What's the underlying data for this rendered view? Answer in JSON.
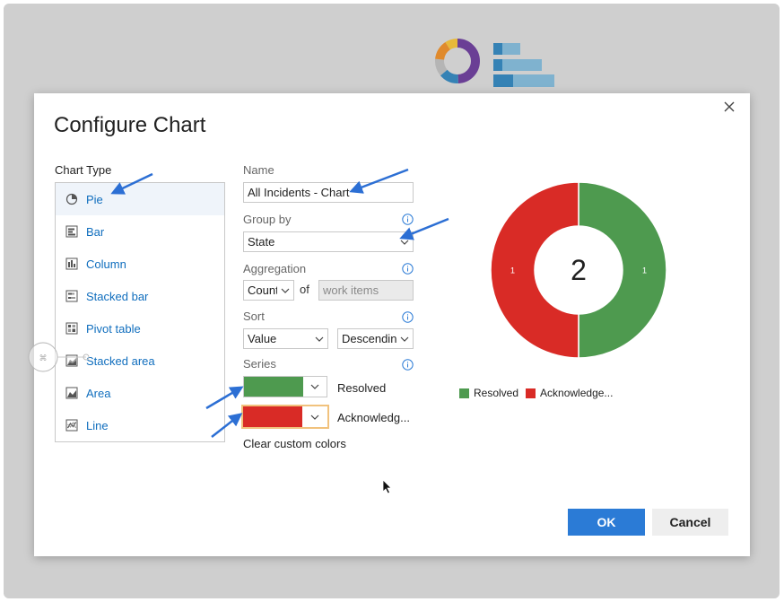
{
  "dialog": {
    "title": "Configure Chart"
  },
  "chart_type": {
    "label": "Chart Type",
    "selected": "Pie",
    "items": [
      {
        "label": "Pie",
        "icon": "pie-icon"
      },
      {
        "label": "Bar",
        "icon": "bar-icon"
      },
      {
        "label": "Column",
        "icon": "column-icon"
      },
      {
        "label": "Stacked bar",
        "icon": "stacked-bar-icon"
      },
      {
        "label": "Pivot table",
        "icon": "pivot-table-icon"
      },
      {
        "label": "Stacked area",
        "icon": "stacked-area-icon"
      },
      {
        "label": "Area",
        "icon": "area-icon"
      },
      {
        "label": "Line",
        "icon": "line-icon"
      }
    ]
  },
  "form": {
    "name_label": "Name",
    "name_value": "All Incidents - Chart",
    "group_by_label": "Group by",
    "group_by_value": "State",
    "aggregation_label": "Aggregation",
    "aggregation_value": "Count",
    "of_label": "of",
    "aggregation_field": "work items",
    "sort_label": "Sort",
    "sort_value": "Value",
    "sort_direction": "Descending",
    "series_label": "Series",
    "series": [
      {
        "name": "Resolved",
        "color": "#4e9a4f"
      },
      {
        "name": "Acknowledg...",
        "color": "#d92b26"
      }
    ],
    "clear_colors_label": "Clear custom colors"
  },
  "chart_data": {
    "type": "pie",
    "donut": true,
    "center_label": "2",
    "series": [
      {
        "name": "Resolved",
        "value": 1,
        "label": "1",
        "color": "#4e9a4f"
      },
      {
        "name": "Acknowledged",
        "value": 1,
        "label": "1",
        "color": "#d92b26"
      }
    ],
    "legend": [
      "Resolved",
      "Acknowledge..."
    ],
    "legend_placement": "bottom"
  },
  "buttons": {
    "ok": "OK",
    "cancel": "Cancel"
  },
  "colors": {
    "accent": "#2b7bd6",
    "link": "#106ebe",
    "annotation_arrow": "#2c6fd4"
  }
}
